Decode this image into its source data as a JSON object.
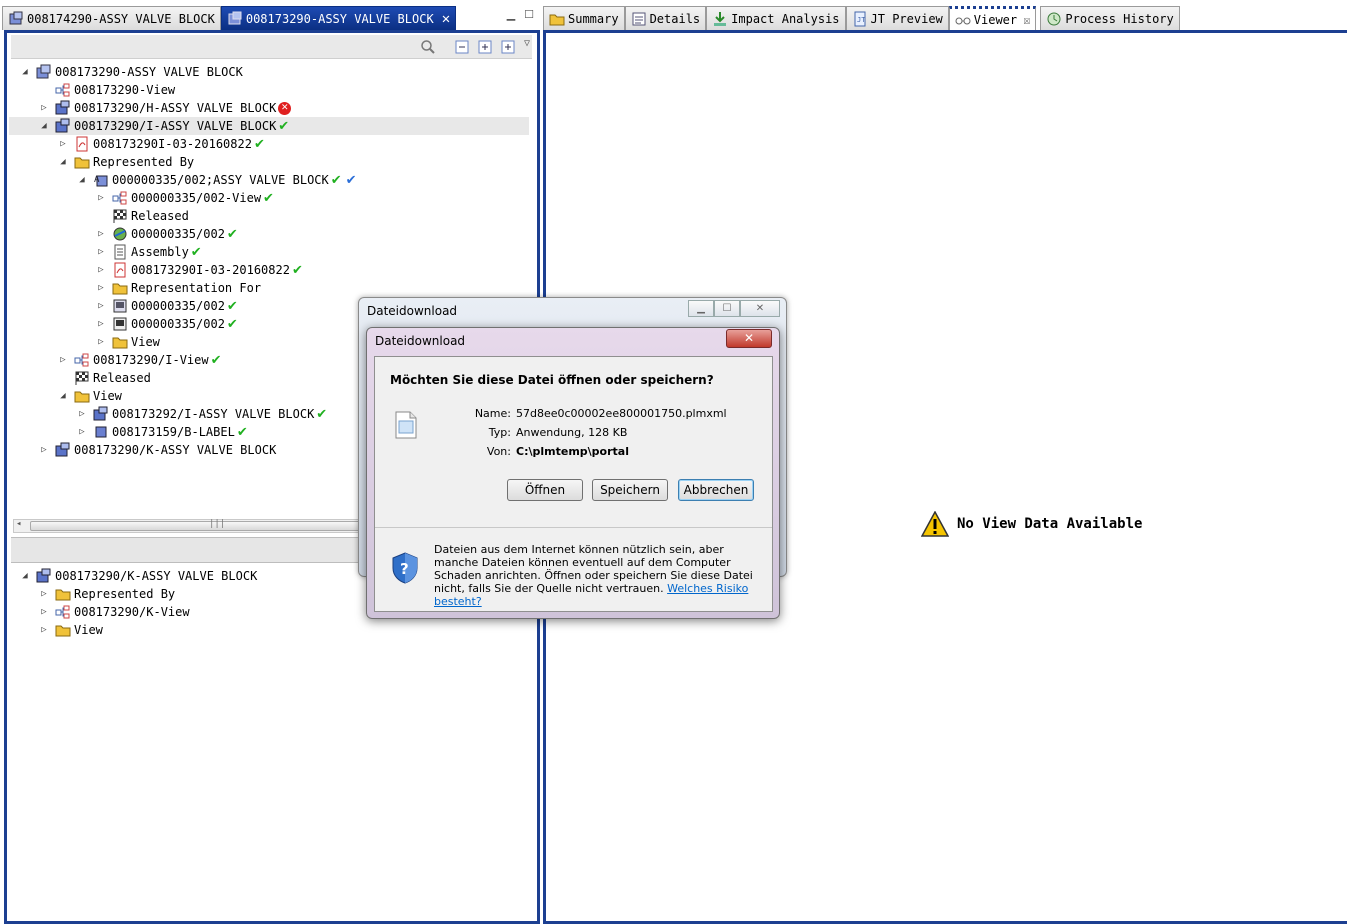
{
  "left_tabs": [
    {
      "label": "008174290-ASSY VALVE BLOCK",
      "active": false
    },
    {
      "label": "008173290-ASSY VALVE BLOCK",
      "active": true
    }
  ],
  "right_tabs": [
    {
      "label": "Summary"
    },
    {
      "label": "Details"
    },
    {
      "label": "Impact Analysis"
    },
    {
      "label": "JT Preview"
    },
    {
      "label": "Viewer",
      "active": true
    },
    {
      "label": "Process History"
    }
  ],
  "tree_top": [
    {
      "label": "008173290-ASSY VALVE BLOCK"
    },
    {
      "label": "008173290-View"
    },
    {
      "label": "008173290/H-ASSY VALVE BLOCK"
    },
    {
      "label": "008173290/I-ASSY VALVE BLOCK"
    },
    {
      "label": "008173290I-03-20160822"
    },
    {
      "label": "Represented By"
    },
    {
      "label": "000000335/002;ASSY VALVE BLOCK"
    },
    {
      "label": "000000335/002-View"
    },
    {
      "label": "Released"
    },
    {
      "label": "000000335/002"
    },
    {
      "label": "Assembly"
    },
    {
      "label": "008173290I-03-20160822"
    },
    {
      "label": "Representation For"
    },
    {
      "label": "000000335/002"
    },
    {
      "label": "000000335/002"
    },
    {
      "label": "View"
    },
    {
      "label": "008173290/I-View"
    },
    {
      "label": "Released"
    },
    {
      "label": "View"
    },
    {
      "label": "008173292/I-ASSY VALVE BLOCK"
    },
    {
      "label": "008173159/B-LABEL"
    },
    {
      "label": "008173290/K-ASSY VALVE BLOCK"
    }
  ],
  "tree_bottom": [
    {
      "label": "008173290/K-ASSY VALVE BLOCK"
    },
    {
      "label": "Represented By"
    },
    {
      "label": "008173290/K-View"
    },
    {
      "label": "View"
    }
  ],
  "viewer": {
    "message": "No View Data Available"
  },
  "dialog_back": {
    "title": "Dateidownload"
  },
  "dialog": {
    "title": "Dateidownload",
    "question": "Möchten Sie diese Datei öffnen oder speichern?",
    "name_label": "Name:",
    "name_value": "57d8ee0c00002ee800001750.plmxml",
    "type_label": "Typ:",
    "type_value": "Anwendung, 128 KB",
    "from_label": "Von:",
    "from_value": "C:\\plmtemp\\portal",
    "open_button": "Öffnen",
    "save_button": "Speichern",
    "cancel_button": "Abbrechen",
    "warning_text": "Dateien aus dem Internet können nützlich sein, aber manche Dateien können eventuell auf dem Computer Schaden anrichten. Öffnen oder speichern Sie diese Datei nicht, falls Sie der Quelle nicht vertrauen.",
    "risk_link": "Welches Risiko besteht?"
  },
  "colors": {
    "frame_blue": "#1c3f91",
    "check_green": "#20b020",
    "error_red": "#e02020"
  }
}
